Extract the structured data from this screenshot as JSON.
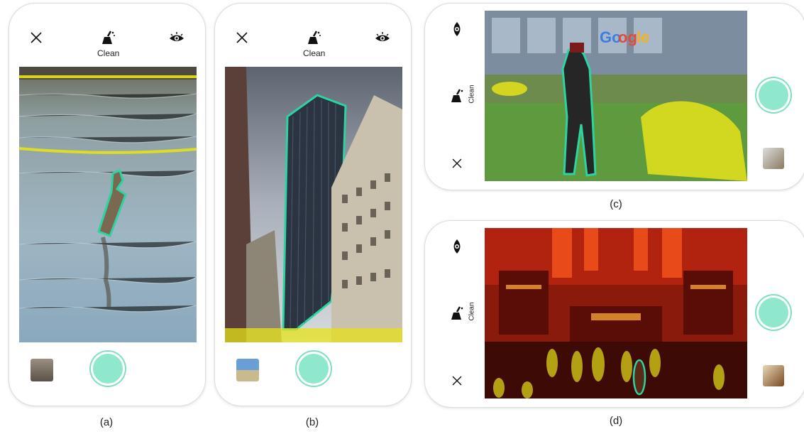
{
  "panels": [
    {
      "id": "a",
      "caption": "(a)",
      "mode_label": "Clean"
    },
    {
      "id": "b",
      "caption": "(b)",
      "mode_label": "Clean"
    },
    {
      "id": "c",
      "caption": "(c)",
      "mode_label": "Clean"
    },
    {
      "id": "d",
      "caption": "(d)",
      "mode_label": "Clean"
    }
  ],
  "icons": {
    "close": "close-icon",
    "clean": "broom-icon",
    "view": "eye-icon"
  },
  "colors": {
    "shutter": "#8fe8cd",
    "select_outline": "#2ed3a2",
    "highlight": "#e6e21a"
  }
}
